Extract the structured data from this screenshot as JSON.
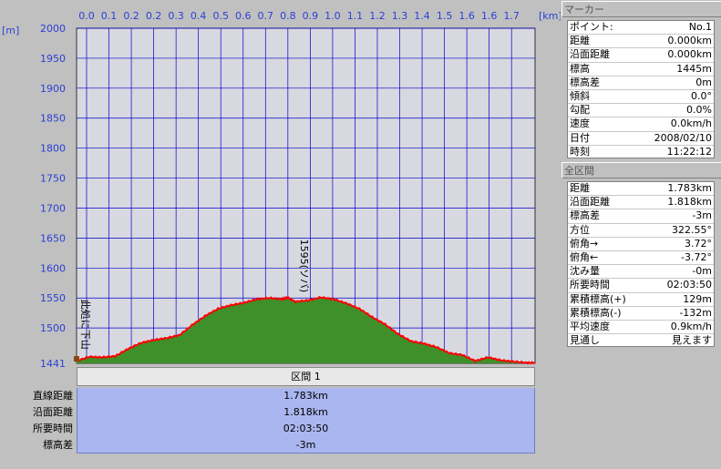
{
  "chart_data": {
    "type": "area",
    "x_unit_label": "[km]",
    "y_unit_label": "[m]",
    "x_ticks": [
      "0.0",
      "0.1",
      "0.2",
      "0.2",
      "0.3",
      "0.4",
      "0.5",
      "0.6",
      "0.7",
      "0.8",
      "0.9",
      "1.0",
      "1.1",
      "1.2",
      "1.3",
      "1.4",
      "1.5",
      "1.6",
      "1.6",
      "1.7"
    ],
    "y_ticks": [
      2000,
      1950,
      1900,
      1850,
      1800,
      1750,
      1700,
      1650,
      1600,
      1550,
      1500
    ],
    "y_min_label": "1441",
    "xlim": [
      0,
      1.783
    ],
    "ylim": [
      1441,
      2000
    ],
    "grid": true,
    "fill_color": "#3f8f2a",
    "line_color": "#ff0000",
    "plot_bg": "#d8d8e0",
    "grid_color": "#0000cc",
    "x": [
      0.0,
      0.05,
      0.1,
      0.15,
      0.2,
      0.25,
      0.3,
      0.35,
      0.4,
      0.45,
      0.5,
      0.55,
      0.6,
      0.65,
      0.7,
      0.75,
      0.8,
      0.82,
      0.85,
      0.9,
      0.95,
      1.0,
      1.05,
      1.1,
      1.15,
      1.2,
      1.25,
      1.3,
      1.35,
      1.4,
      1.45,
      1.5,
      1.55,
      1.6,
      1.65,
      1.7,
      1.75,
      1.783
    ],
    "y": [
      1445,
      1452,
      1451,
      1453,
      1465,
      1475,
      1480,
      1483,
      1488,
      1505,
      1520,
      1532,
      1538,
      1542,
      1548,
      1550,
      1548,
      1551,
      1544,
      1546,
      1551,
      1548,
      1541,
      1532,
      1518,
      1506,
      1490,
      1478,
      1474,
      1468,
      1458,
      1455,
      1445,
      1451,
      1446,
      1444,
      1442,
      1442
    ],
    "annotations": [
      {
        "text": "此処に下山",
        "x": 0.05,
        "y": 1455
      },
      {
        "text": "1595(ソバ)",
        "x": 0.9,
        "y": 1550
      }
    ]
  },
  "section": {
    "title": "区間 1",
    "rows": [
      {
        "label": "直線距離",
        "value": "1.783km"
      },
      {
        "label": "沿面距離",
        "value": "1.818km"
      },
      {
        "label": "所要時間",
        "value": "02:03:50"
      },
      {
        "label": "標高差",
        "value": "-3m"
      }
    ]
  },
  "marker": {
    "title": "マーカー",
    "rows": [
      {
        "k": "ポイント:",
        "v": "No.1"
      },
      {
        "k": "距離",
        "v": "0.000km"
      },
      {
        "k": "沿面距離",
        "v": "0.000km"
      },
      {
        "k": "標高",
        "v": "1445m"
      },
      {
        "k": "標高差",
        "v": "0m"
      },
      {
        "k": "傾斜",
        "v": "0.0°"
      },
      {
        "k": "勾配",
        "v": "0.0%"
      },
      {
        "k": "速度",
        "v": "0.0km/h"
      },
      {
        "k": "日付",
        "v": "2008/02/10"
      },
      {
        "k": "時刻",
        "v": "11:22:12"
      }
    ]
  },
  "whole": {
    "title": "全区間",
    "rows": [
      {
        "k": "距離",
        "v": "1.783km"
      },
      {
        "k": "沿面距離",
        "v": "1.818km"
      },
      {
        "k": "標高差",
        "v": "-3m"
      },
      {
        "k": "方位",
        "v": "322.55°"
      },
      {
        "k": "俯角→",
        "v": "3.72°"
      },
      {
        "k": "俯角←",
        "v": "-3.72°"
      },
      {
        "k": "沈み量",
        "v": "-0m"
      },
      {
        "k": "所要時間",
        "v": "02:03:50"
      },
      {
        "k": "累積標高(+)",
        "v": "129m"
      },
      {
        "k": "累積標高(-)",
        "v": "-132m"
      },
      {
        "k": "平均速度",
        "v": "0.9km/h"
      },
      {
        "k": "見通し",
        "v": "見えます"
      }
    ]
  }
}
